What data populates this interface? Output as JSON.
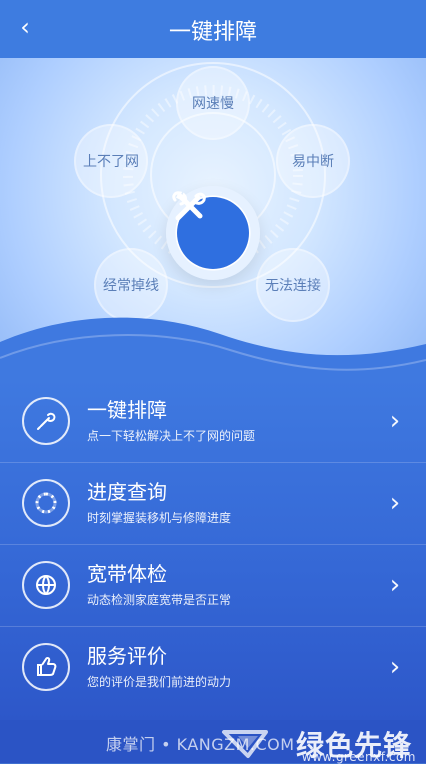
{
  "header": {
    "title": "一键排障",
    "back_icon": "chevron-left-icon"
  },
  "hero": {
    "bubbles": {
      "top": "网速慢",
      "left": "上不了网",
      "right": "易中断",
      "bottom_left": "经常掉线",
      "bottom_right": "无法连接"
    },
    "center_icon": "tools-icon"
  },
  "menu": [
    {
      "title": "一键排障",
      "subtitle": "点一下轻松解决上不了网的问题",
      "icon": "wrench-icon"
    },
    {
      "title": "进度查询",
      "subtitle": "时刻掌握装移机与修障进度",
      "icon": "progress-icon"
    },
    {
      "title": "宽带体检",
      "subtitle": "动态检测家庭宽带是否正常",
      "icon": "globe-icon"
    },
    {
      "title": "服务评价",
      "subtitle": "您的评价是我们前进的动力",
      "icon": "thumbs-up-icon"
    }
  ],
  "watermarks": {
    "left": "康掌门 • KANGZM.COM",
    "right_cn": "绿色先锋",
    "right_url": "www.greenxf.com"
  },
  "colors": {
    "topbar": "#3e7ce0",
    "accent": "#2f6fe0",
    "list_bg": "#3568d6"
  }
}
